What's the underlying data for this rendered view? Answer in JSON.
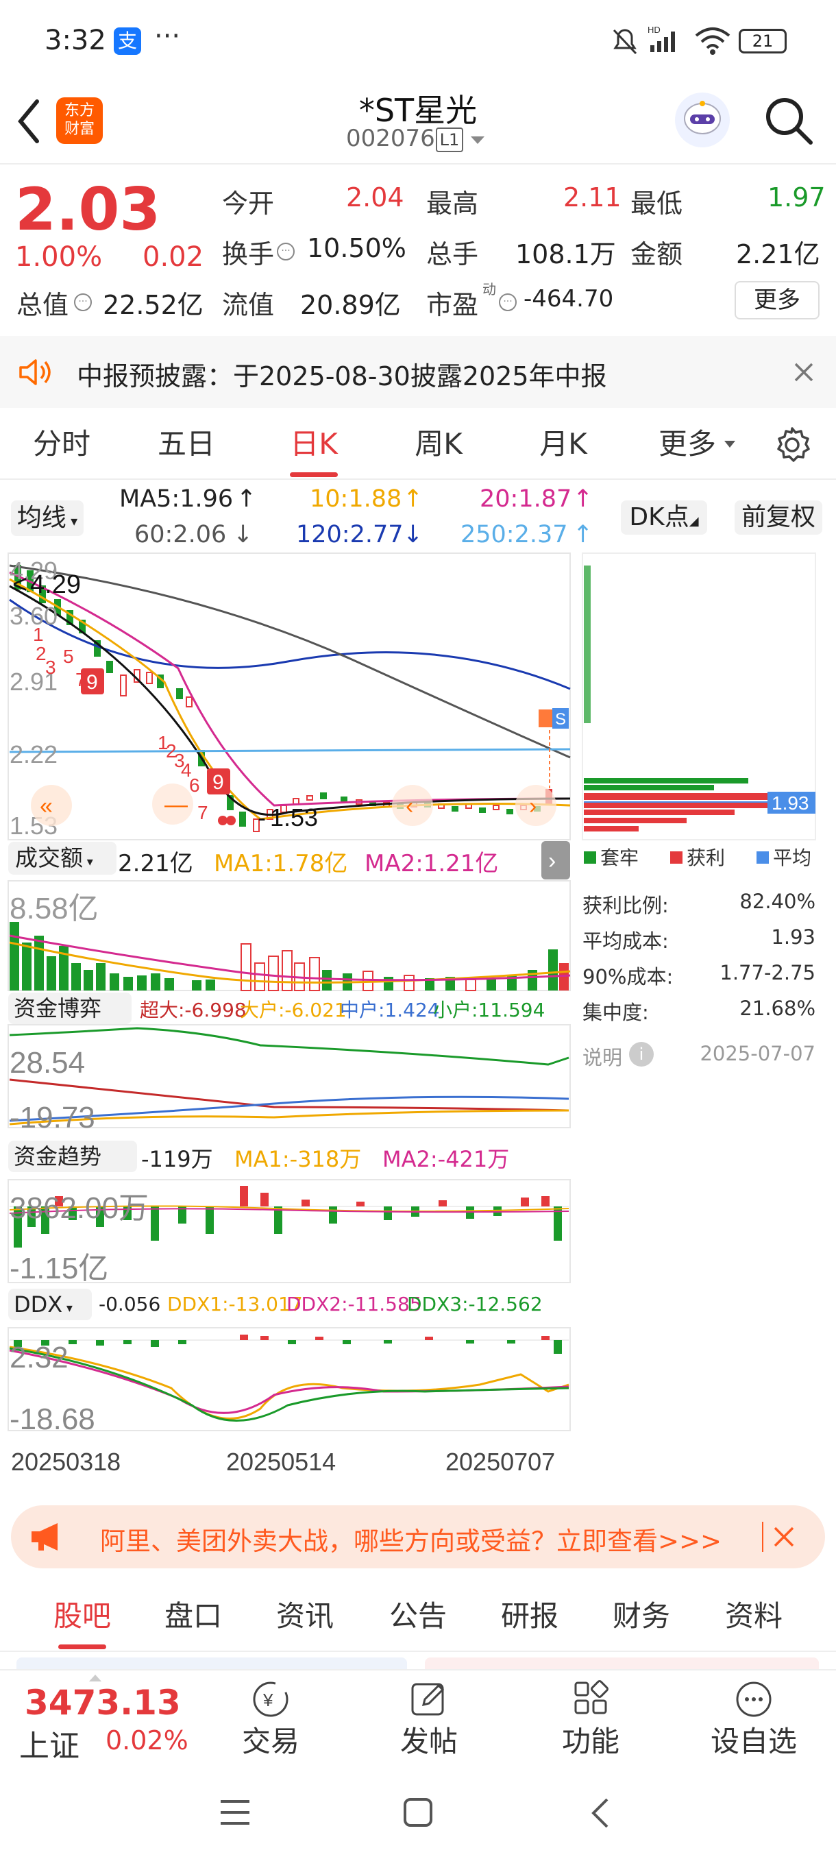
{
  "status_bar": {
    "time": "3:32",
    "app_badge": "支",
    "battery": "21"
  },
  "header": {
    "logo_line1": "东方",
    "logo_line2": "财富",
    "stock_name": "*ST星光",
    "stock_code": "002076",
    "level": "L1"
  },
  "quote": {
    "price": "2.03",
    "change_pct": "1.00%",
    "change": "0.02",
    "rows": [
      {
        "label": "今开",
        "value": "2.04",
        "label2": "最高",
        "value2": "2.11",
        "label3": "最低",
        "value3": "1.97"
      },
      {
        "label": "换手",
        "value": "10.50%",
        "label2": "总手",
        "value2": "108.1万",
        "label3": "金额",
        "value3": "2.21亿"
      }
    ],
    "total_cap_label": "总值",
    "total_cap": "22.52亿",
    "float_label": "流值",
    "float_cap": "20.89亿",
    "pe_label": "市盈",
    "pe_sup": "动",
    "pe": "-464.70",
    "more_button": "更多"
  },
  "notice": {
    "text": "中报预披露：于2025-08-30披露2025年中报"
  },
  "chart_tabs": [
    "分时",
    "五日",
    "日K",
    "周K",
    "月K",
    "更多"
  ],
  "active_tab": "日K",
  "ma_bar": {
    "selector": "均线",
    "ma5": "MA5:1.96",
    "ma10": "10:1.88",
    "ma20": "20:1.87",
    "ma60": "60:2.06",
    "ma120": "120:2.77",
    "ma250": "250:2.37",
    "dk_button": "DK点",
    "adjust_button": "前复权"
  },
  "kline_labels": {
    "high_top": "4.29",
    "high_marker": "4.29",
    "y1": "3.60",
    "y2": "2.91",
    "y3": "2.22",
    "y4": "1.53",
    "low_marker": "1.53",
    "cost_tag": "1.93",
    "sell_tag": "S"
  },
  "volume": {
    "selector": "成交额",
    "value": "2.21亿",
    "ma1": "MA1:1.78亿",
    "ma2": "MA2:1.21亿",
    "axis_max": "8.58亿"
  },
  "fund_game": {
    "title": "资金博弈",
    "super": "超大:-6.998",
    "large": "大户:-6.021",
    "mid": "中户:1.424",
    "small": "小户:11.594",
    "y_top": "28.54",
    "y_bottom": "-19.73"
  },
  "fund_trend": {
    "title": "资金趋势",
    "value": "-119万",
    "ma1": "MA1:-318万",
    "ma2": "MA2:-421万",
    "y_top": "3862.00万",
    "y_bottom": "-1.15亿"
  },
  "ddx": {
    "title": "DDX",
    "value": "-0.056",
    "ddx1": "DDX1:-13.017",
    "ddx2": "DDX2:-11.585",
    "ddx3": "DDX3:-12.562",
    "y_top": "2.32",
    "y_bottom": "-18.68"
  },
  "dates": [
    "20250318",
    "20250514",
    "20250707"
  ],
  "chip_panel": {
    "legend": [
      "套牢",
      "获利",
      "平均"
    ],
    "stats": [
      {
        "label": "获利比例:",
        "value": "82.40%"
      },
      {
        "label": "平均成本:",
        "value": "1.93"
      },
      {
        "label": "90%成本:",
        "value": "1.77-2.75"
      },
      {
        "label": "集中度:",
        "value": "21.68%"
      }
    ],
    "note_label": "说明",
    "note_date": "2025-07-07"
  },
  "ad_banner": "阿里、美团外卖大战，哪些方向或受益？立即查看>>>",
  "bottom_tabs": [
    "股吧",
    "盘口",
    "资讯",
    "公告",
    "研报",
    "财务",
    "资料"
  ],
  "index": {
    "value": "3473.13",
    "name": "上证",
    "change": "0.02%"
  },
  "bottom_nav": [
    "交易",
    "发帖",
    "功能",
    "设自选"
  ],
  "colors": {
    "up": "#e4393c",
    "down": "#1a9a2a",
    "accent": "#ff6a00"
  }
}
